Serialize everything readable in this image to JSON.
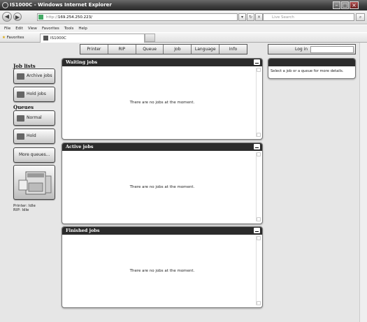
{
  "window": {
    "title": "IS1000C - Windows Internet Explorer"
  },
  "browser": {
    "address_scheme": "http://",
    "address_host": "169.254.250.223/",
    "search_placeholder": "Live Search",
    "menu": [
      "File",
      "Edit",
      "View",
      "Favorites",
      "Tools",
      "Help"
    ],
    "favorites_label": "Favorites",
    "tab_title": "IS1000C"
  },
  "nav": {
    "items": [
      "Printer",
      "RIP",
      "Queue",
      "Job",
      "Language",
      "Info"
    ],
    "login_label": "Log in"
  },
  "sidebar": {
    "job_lists_heading": "Job lists",
    "archive_jobs": "Archive jobs",
    "hold_jobs": "Hold jobs",
    "queues_heading": "Queues",
    "normal": "Normal",
    "hold": "Hold",
    "more_queues": "More queues...",
    "printer_status": "Printer: Idle",
    "rip_status": "RIP: Idle"
  },
  "panels": {
    "waiting": {
      "title": "Waiting jobs",
      "empty": "There are no jobs at the moment."
    },
    "active": {
      "title": "Active jobs",
      "empty": "There are no jobs at the moment."
    },
    "finished": {
      "title": "Finished jobs",
      "empty": "There are no jobs at the moment."
    }
  },
  "details": {
    "hint": "Select a job or a queue for more details."
  },
  "icons": [
    "ie-icon",
    "back-icon",
    "forward-icon",
    "refresh-icon",
    "stop-icon",
    "search-icon",
    "star-icon",
    "archive-icon",
    "hold-icon",
    "queue-icon",
    "printer-icon",
    "minimize-icon"
  ]
}
